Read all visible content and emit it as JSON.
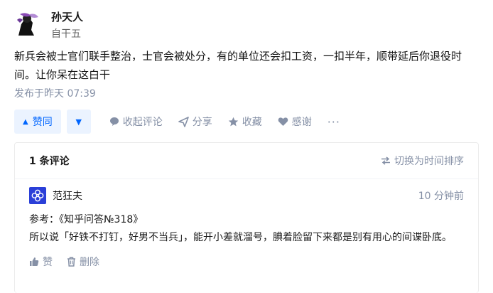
{
  "author": {
    "name": "孙天人",
    "headline": "自干五"
  },
  "answer": {
    "content": "新兵会被士官们联手整治，士官会被处分，有的单位还会扣工资，一扣半年，顺带延后你退役时间。让你呆在这白干",
    "time": "发布于昨天 07:39"
  },
  "actions": {
    "upvote_label": "赞同",
    "collapse_comments": "收起评论",
    "share": "分享",
    "favorite": "收藏",
    "thanks": "感谢",
    "more": "···"
  },
  "comments": {
    "count_label": "1 条评论",
    "sort_label": "切换为时间排序",
    "items": [
      {
        "user": "范狂夫",
        "time": "10 分钟前",
        "line1": "参考：《知乎问答№318》",
        "line2": "所以说「好铁不打钉，好男不当兵」，能开小差就溜号，腆着脸留下来都是别有用心的间谍卧底。",
        "like_label": "赞",
        "delete_label": "删除"
      }
    ]
  },
  "colors": {
    "accent": "#0066ff",
    "accent_bg": "#ebf3ff",
    "muted": "#8590a6"
  }
}
